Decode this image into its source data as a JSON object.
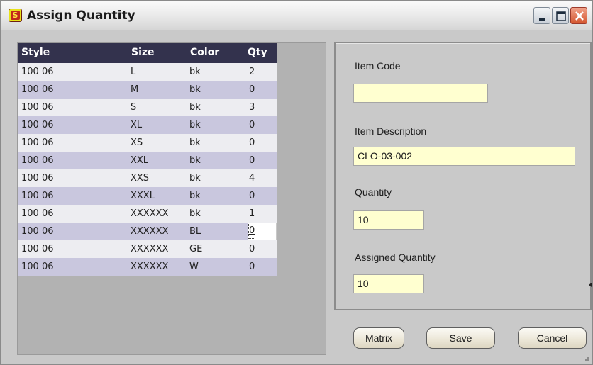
{
  "window": {
    "title": "Assign Quantity",
    "icon_name": "app-logo-icon",
    "controls": [
      "minimize-icon",
      "maximize-icon",
      "close-icon"
    ]
  },
  "grid": {
    "columns": [
      "Style",
      "Size",
      "Color",
      "Qty"
    ],
    "rows": [
      {
        "style": "100 06",
        "size": "L",
        "color": "bk",
        "qty": "2"
      },
      {
        "style": "100 06",
        "size": "M",
        "color": "bk",
        "qty": "0"
      },
      {
        "style": "100 06",
        "size": "S",
        "color": "bk",
        "qty": "3"
      },
      {
        "style": "100 06",
        "size": "XL",
        "color": "bk",
        "qty": "0"
      },
      {
        "style": "100 06",
        "size": "XS",
        "color": "bk",
        "qty": "0"
      },
      {
        "style": "100 06",
        "size": "XXL",
        "color": "bk",
        "qty": "0"
      },
      {
        "style": "100 06",
        "size": "XXS",
        "color": "bk",
        "qty": "4"
      },
      {
        "style": "100 06",
        "size": "XXXL",
        "color": "bk",
        "qty": "0"
      },
      {
        "style": "100 06",
        "size": "XXXXXX",
        "color": "bk",
        "qty": "1"
      },
      {
        "style": "100 06",
        "size": "XXXXXX",
        "color": "BL",
        "qty": "0"
      },
      {
        "style": "100 06",
        "size": "XXXXXX",
        "color": "GE",
        "qty": "0"
      },
      {
        "style": "100 06",
        "size": "XXXXXX",
        "color": "W",
        "qty": "0"
      }
    ],
    "header_color": "#33324d",
    "row_colors": [
      "#ededf1",
      "#c9c7de"
    ]
  },
  "fields": {
    "item_code": {
      "label": "Item Code",
      "value": ""
    },
    "item_description": {
      "label": "Item Description",
      "value": "CLO-03-002"
    },
    "quantity": {
      "label": "Quantity",
      "value": "10"
    },
    "assigned_quantity": {
      "label": "Assigned Quantity",
      "value": "10"
    },
    "input_background": "#ffffd0"
  },
  "buttons": {
    "matrix": "Matrix",
    "save": "Save",
    "cancel": "Cancel"
  }
}
